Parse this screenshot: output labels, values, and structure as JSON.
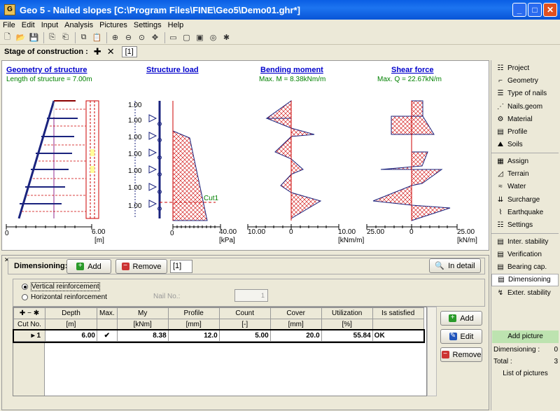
{
  "window": {
    "title": "Geo 5 - Nailed slopes [C:\\Program Files\\FINE\\Geo5\\Demo01.ghr*]"
  },
  "menu": [
    "File",
    "Edit",
    "Input",
    "Analysis",
    "Pictures",
    "Settings",
    "Help"
  ],
  "stage": {
    "label": "Stage of construction :",
    "tab": "[1]"
  },
  "charts": {
    "geometry": {
      "title": "Geometry of structure",
      "subtitle": "Length of structure = 7.00m",
      "axis_start": "0",
      "axis_end": "6.00",
      "unit": "[m]"
    },
    "load": {
      "title": "Structure load",
      "cut_label": "Cut1",
      "axis_start": "0",
      "axis_end": "40.00",
      "unit": "[kPa]",
      "tick_label": "1.00"
    },
    "moment": {
      "title": "Bending moment",
      "subtitle": "Max. M = 8.38kNm/m",
      "axis_start": "10.00",
      "axis_mid": "0",
      "axis_end": "10.00",
      "unit": "[kNm/m]"
    },
    "shear": {
      "title": "Shear force",
      "subtitle": "Max. Q = 22.67kN/m",
      "axis_start": "25.00",
      "axis_mid": "0",
      "axis_end": "25.00",
      "unit": "[kN/m]"
    }
  },
  "dimensioning": {
    "label": "Dimensioning:",
    "add": "Add",
    "remove": "Remove",
    "tab": "[1]",
    "in_detail": "In detail",
    "radio_vertical": "Vertical reinforcement",
    "radio_horizontal": "Horizontal reinforcement",
    "nail_no_label": "Nail No.:",
    "nail_no_value": "1"
  },
  "table": {
    "headers": [
      "Cut No.",
      "Depth",
      "Max.",
      "My",
      "Profile",
      "Count",
      "Cover",
      "Utilization",
      "Is satisfied"
    ],
    "units": [
      "",
      "[m]",
      "",
      "[kNm]",
      "[mm]",
      "[-]",
      "[mm]",
      "[%]",
      ""
    ],
    "rows": [
      {
        "cut": "1",
        "depth": "6.00",
        "max": "✔",
        "my": "8.38",
        "profile": "12.0",
        "count": "5.00",
        "cover": "20.0",
        "util": "55.84",
        "ok": "OK"
      }
    ]
  },
  "side_buttons": {
    "add": "Add",
    "edit": "Edit",
    "remove": "Remove"
  },
  "sidebar": {
    "items": [
      "Project",
      "Geometry",
      "Type of nails",
      "Nails.geom",
      "Material",
      "Profile",
      "Soils",
      "Assign",
      "Terrain",
      "Water",
      "Surcharge",
      "Earthquake",
      "Settings",
      "Inter. stability",
      "Verification",
      "Bearing cap.",
      "Dimensioning",
      "Exter. stability"
    ],
    "add_picture": "Add picture",
    "dim_count_label": "Dimensioning :",
    "dim_count": "0",
    "total_label": "Total :",
    "total": "3",
    "list_pictures": "List of pictures"
  },
  "colors": {
    "title_blue": "#0000cc",
    "subtitle_green": "#008000",
    "hatch": "#cc0000"
  }
}
